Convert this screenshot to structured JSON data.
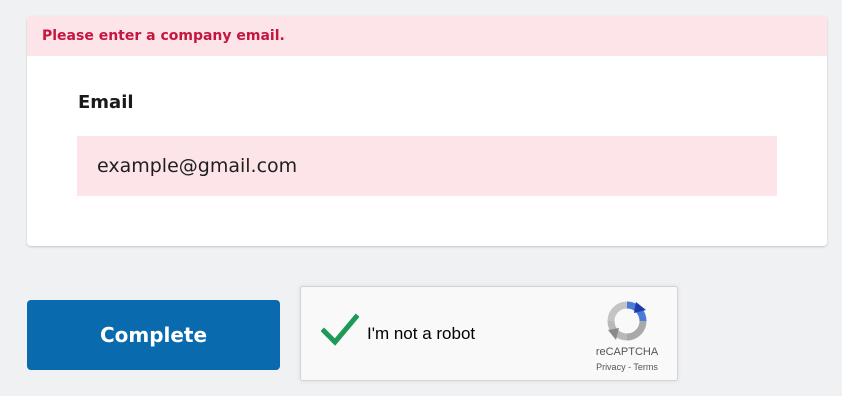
{
  "form": {
    "error_message": "Please enter a company email.",
    "email_label": "Email",
    "email_value": "example@gmail.com"
  },
  "actions": {
    "complete_label": "Complete"
  },
  "recaptcha": {
    "label": "I'm not a robot",
    "brand": "reCAPTCHA",
    "privacy_link": "Privacy",
    "separator": " - ",
    "terms_link": "Terms",
    "checked": true
  },
  "colors": {
    "error_text": "#c4163f",
    "error_background": "#fce4e9",
    "primary_button": "#0a6aae",
    "checkmark": "#1d9a57"
  },
  "icons": {
    "check": "check-icon",
    "recaptcha_logo": "recaptcha-logo-icon"
  }
}
